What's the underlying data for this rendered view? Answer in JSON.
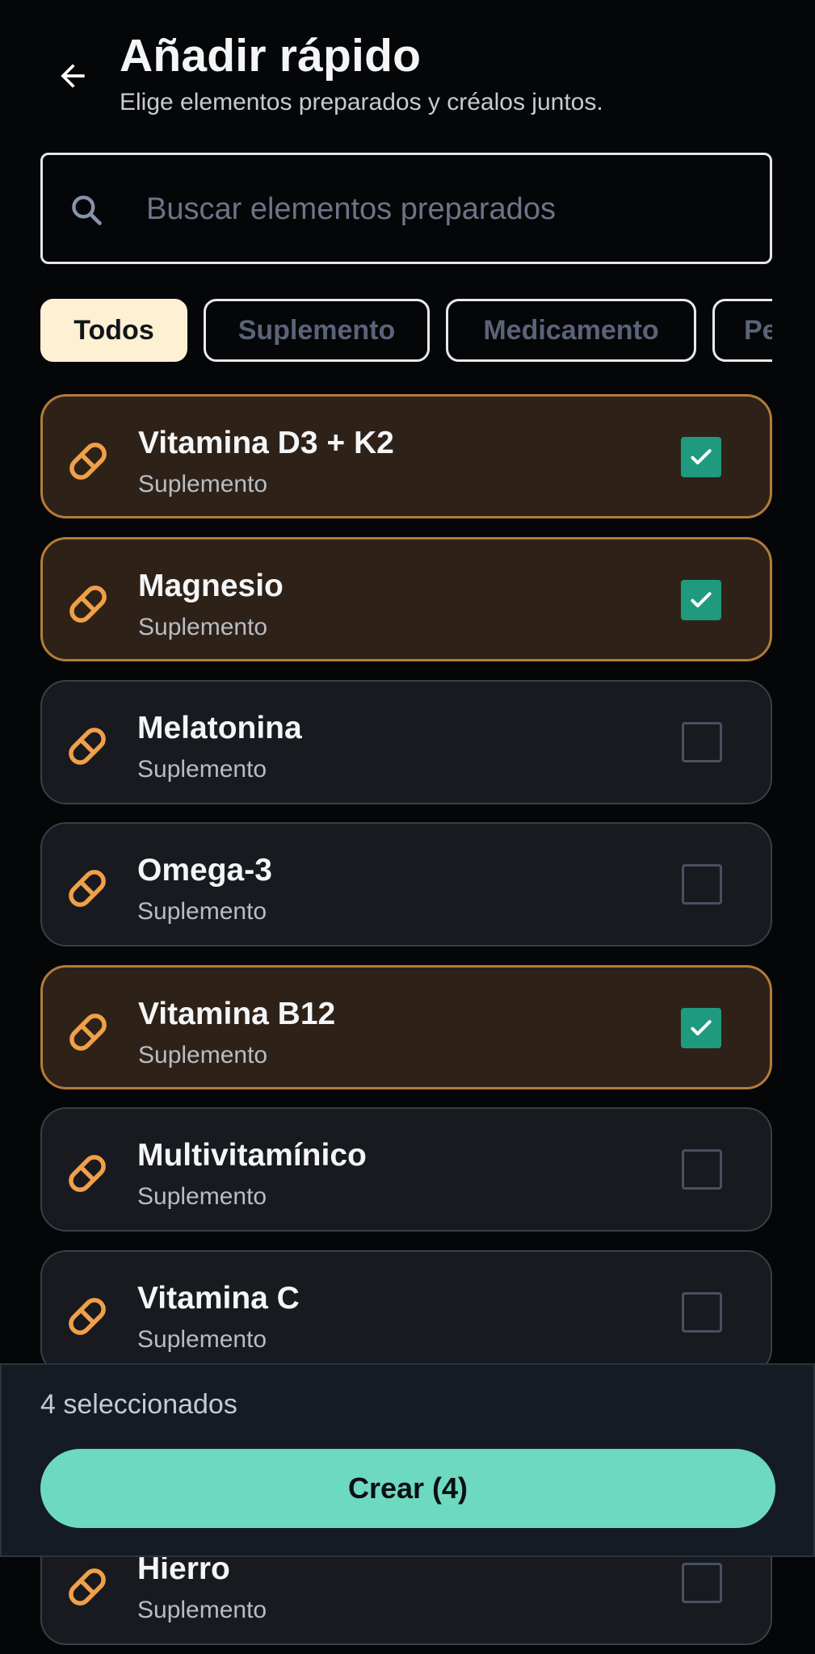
{
  "header": {
    "title": "Añadir rápido",
    "subtitle": "Elige elementos preparados y créalos juntos.",
    "back_icon": "arrow-left-icon"
  },
  "search": {
    "placeholder": "Buscar elementos preparados",
    "value": "",
    "icon": "search-icon"
  },
  "filters": [
    {
      "label": "Todos",
      "active": true
    },
    {
      "label": "Suplemento",
      "active": false
    },
    {
      "label": "Medicamento",
      "active": false
    },
    {
      "label": "Pe",
      "active": false
    }
  ],
  "items": [
    {
      "name": "Vitamina D3 + K2",
      "category": "Suplemento",
      "selected": true,
      "icon": "pill-icon"
    },
    {
      "name": "Magnesio",
      "category": "Suplemento",
      "selected": true,
      "icon": "pill-icon"
    },
    {
      "name": "Melatonina",
      "category": "Suplemento",
      "selected": false,
      "icon": "pill-icon"
    },
    {
      "name": "Omega-3",
      "category": "Suplemento",
      "selected": false,
      "icon": "pill-icon"
    },
    {
      "name": "Vitamina B12",
      "category": "Suplemento",
      "selected": true,
      "icon": "pill-icon"
    },
    {
      "name": "Multivitamínico",
      "category": "Suplemento",
      "selected": false,
      "icon": "pill-icon"
    },
    {
      "name": "Vitamina C",
      "category": "Suplemento",
      "selected": false,
      "icon": "pill-icon"
    },
    {
      "name": "Hierro",
      "category": "Suplemento",
      "selected": false,
      "icon": "pill-icon"
    }
  ],
  "footer": {
    "selected_count_text": "4 seleccionados",
    "create_label": "Crear (4)"
  },
  "colors": {
    "background": "#050608",
    "accent_orange": "#f0a048",
    "selected_card_bg": "#2e2218",
    "selected_card_border": "#b57a3a",
    "checkbox_checked": "#1f9a7e",
    "create_button": "#6dd9c0",
    "active_chip": "#fdf0d3"
  }
}
